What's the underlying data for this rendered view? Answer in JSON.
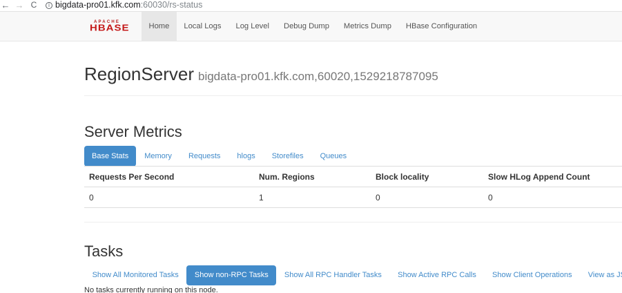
{
  "browser": {
    "url_host": "bigdata-pro01.kfk.com",
    "url_path": ":60030/rs-status",
    "back_icon": "←",
    "forward_icon": "→",
    "reload_icon": "C",
    "info_icon": "i"
  },
  "navbar": {
    "logo_apache": "APACHE",
    "logo_hbase": "HBASE",
    "links": [
      "Home",
      "Local Logs",
      "Log Level",
      "Debug Dump",
      "Metrics Dump",
      "HBase Configuration"
    ],
    "active_link": "Home"
  },
  "header": {
    "title": "RegionServer",
    "subtitle": "bigdata-pro01.kfk.com,60020,1529218787095"
  },
  "server_metrics": {
    "heading": "Server Metrics",
    "tabs": [
      "Base Stats",
      "Memory",
      "Requests",
      "hlogs",
      "Storefiles",
      "Queues"
    ],
    "active_tab": "Base Stats",
    "columns": [
      "Requests Per Second",
      "Num. Regions",
      "Block locality",
      "Slow HLog Append Count"
    ],
    "rows": [
      [
        "0",
        "1",
        "0",
        "0"
      ]
    ]
  },
  "tasks": {
    "heading": "Tasks",
    "filters": [
      "Show All Monitored Tasks",
      "Show non-RPC Tasks",
      "Show All RPC Handler Tasks",
      "Show Active RPC Calls",
      "Show Client Operations",
      "View as JSON"
    ],
    "active_filter": "Show non-RPC Tasks",
    "empty_message": "No tasks currently running on this node."
  },
  "colors": {
    "link": "#428bca",
    "active_pill_bg": "#428bca",
    "navbar_bg": "#f8f8f8",
    "logo_red": "#c41a1a"
  }
}
